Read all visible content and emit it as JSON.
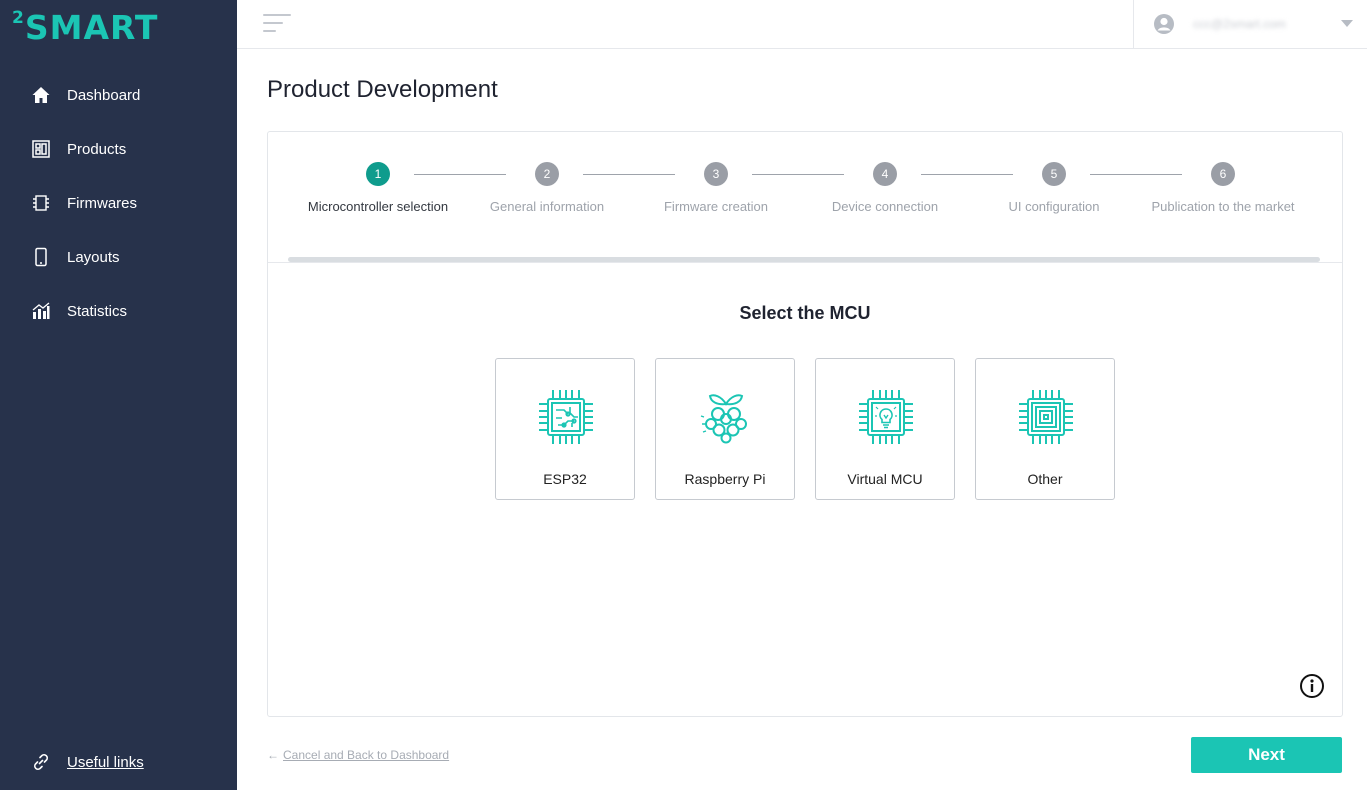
{
  "brand": {
    "superscript": "2",
    "name": "SMART",
    "color": "#1bc5b4"
  },
  "sidebar": {
    "items": [
      {
        "label": "Dashboard",
        "icon": "home-icon"
      },
      {
        "label": "Products",
        "icon": "products-icon"
      },
      {
        "label": "Firmwares",
        "icon": "chip-icon"
      },
      {
        "label": "Layouts",
        "icon": "phone-icon"
      },
      {
        "label": "Statistics",
        "icon": "bar-chart-icon"
      }
    ],
    "footer_link": {
      "label": "Useful links",
      "icon": "link-icon"
    }
  },
  "header": {
    "menu_icon": "hamburger-icon",
    "user": {
      "email": "ccc@2smart.com",
      "icon": "user-avatar-icon"
    }
  },
  "page": {
    "title": "Product Development"
  },
  "wizard": {
    "steps": [
      {
        "number": "1",
        "label": "Microcontroller selection",
        "active": true
      },
      {
        "number": "2",
        "label": "General information",
        "active": false
      },
      {
        "number": "3",
        "label": "Firmware creation",
        "active": false
      },
      {
        "number": "4",
        "label": "Device connection",
        "active": false
      },
      {
        "number": "5",
        "label": "UI configuration",
        "active": false
      },
      {
        "number": "6",
        "label": "Publication to the market",
        "active": false
      }
    ],
    "section_title": "Select the MCU",
    "options": [
      {
        "label": "ESP32",
        "icon": "esp32-chip-icon"
      },
      {
        "label": "Raspberry Pi",
        "icon": "raspberry-pi-icon"
      },
      {
        "label": "Virtual MCU",
        "icon": "virtual-mcu-icon"
      },
      {
        "label": "Other",
        "icon": "other-chip-icon"
      }
    ]
  },
  "footer": {
    "cancel_label": "Cancel and Back to Dashboard",
    "next_label": "Next"
  },
  "colors": {
    "sidebar_bg": "#27324b",
    "accent": "#1bc5b4",
    "active_step": "#0f9c8d",
    "inactive_step": "#9a9ea6"
  }
}
